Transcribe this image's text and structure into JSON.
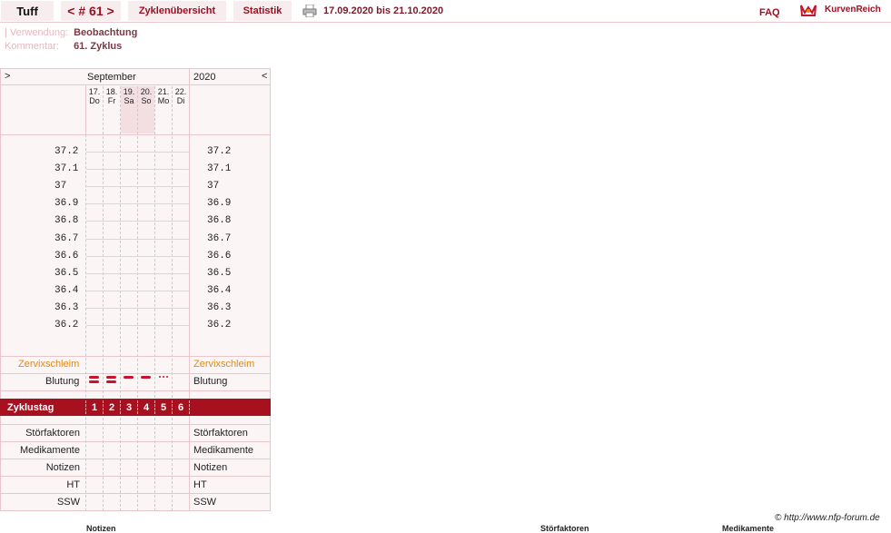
{
  "header": {
    "name": "Tuff",
    "cycle_nav": "< # 61 >",
    "tab_overview": "Zyklenübersicht",
    "tab_stats": "Statistik",
    "date_range": "17.09.2020 bis 21.10.2020",
    "faq": "FAQ",
    "brand": "KurvenReich"
  },
  "meta": {
    "usage_label": "| Verwendung:",
    "usage_value": "Beobachtung",
    "comment_label": "Kommentar:",
    "comment_value": "61. Zyklus"
  },
  "chart": {
    "prev": ">",
    "next": "<",
    "month": "September",
    "year": "2020",
    "days": [
      {
        "d": "17.",
        "w": "Do"
      },
      {
        "d": "18.",
        "w": "Fr"
      },
      {
        "d": "19.",
        "w": "Sa"
      },
      {
        "d": "20.",
        "w": "So"
      },
      {
        "d": "21.",
        "w": "Mo"
      },
      {
        "d": "22.",
        "w": "Di"
      }
    ],
    "temps": [
      "37.2",
      "37.1",
      "37",
      "36.9",
      "36.8",
      "36.7",
      "36.6",
      "36.5",
      "36.4",
      "36.3",
      "36.2"
    ],
    "zervix": "Zervixschleim",
    "blutung": "Blutung",
    "zyklustag": "Zyklustag",
    "cycle_days": [
      "1",
      "2",
      "3",
      "4",
      "5",
      "6"
    ],
    "rows": [
      "Störfaktoren",
      "Medikamente",
      "Notizen",
      "HT",
      "SSW"
    ]
  },
  "footer": {
    "copyright": "© http://www.nfp-forum.de",
    "col_notes": "Notizen",
    "col_disturb": "Störfaktoren",
    "col_meds": "Medikamente"
  },
  "colors": {
    "accent": "#a6101f",
    "zervix": "#e08a1c"
  }
}
